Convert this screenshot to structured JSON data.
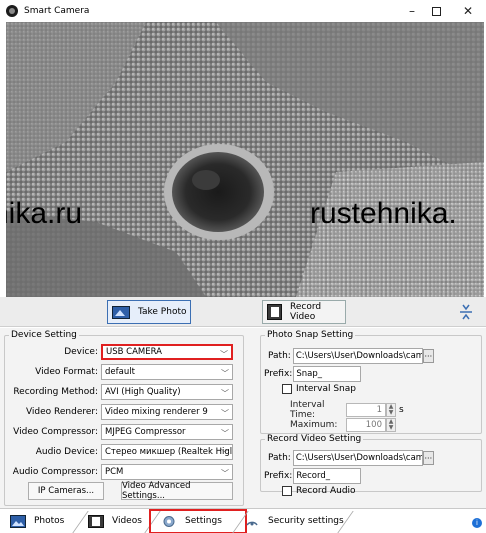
{
  "window": {
    "title": "Smart Camera",
    "controls": {
      "minimize": "–",
      "maximize": "",
      "close": "✕"
    }
  },
  "viewport": {
    "watermarks": [
      "nika.ru",
      "rustehnika."
    ]
  },
  "toolbar": {
    "take_photo": "Take Photo",
    "record_video": "Record Video"
  },
  "device_setting": {
    "legend": "Device Setting",
    "fields": [
      {
        "label": "Device:",
        "value": "USB CAMERA"
      },
      {
        "label": "Video Format:",
        "value": "default"
      },
      {
        "label": "Recording Method:",
        "value": "AVI (High Quality)"
      },
      {
        "label": "Video Renderer:",
        "value": "Video mixing renderer 9"
      },
      {
        "label": "Video Compressor:",
        "value": "MJPEG Compressor"
      },
      {
        "label": "Audio Device:",
        "value": "Стерео микшер (Realtek Higl"
      },
      {
        "label": "Audio Compressor:",
        "value": "PCM"
      }
    ],
    "ip_cameras_button": "IP Cameras...",
    "advanced_button": "Video Advanced Settings..."
  },
  "photo_snap": {
    "legend": "Photo Snap Setting",
    "path_label": "Path:",
    "path_value": "C:\\Users\\User\\Downloads\\camera",
    "browse": "···",
    "prefix_label": "Prefix:",
    "prefix_value": "Snap_",
    "interval_snap_label": "Interval Snap",
    "interval_snap_checked": false,
    "interval_time_label": "Interval Time:",
    "interval_time_value": "1",
    "interval_time_unit": "s",
    "maximum_label": "Maximum:",
    "maximum_value": "100"
  },
  "record_video_setting": {
    "legend": "Record Video Setting",
    "path_label": "Path:",
    "path_value": "C:\\Users\\User\\Downloads\\camera",
    "browse": "···",
    "prefix_label": "Prefix:",
    "prefix_value": "Record_",
    "record_audio_label": "Record Audio",
    "record_audio_checked": false
  },
  "tabs": {
    "photos": "Photos",
    "videos": "Videos",
    "settings": "Settings",
    "security": "Security settings",
    "active": "Settings",
    "info": "i"
  },
  "colors": {
    "highlight": "#e02020",
    "accent": "#3c6fb3",
    "panel_bg": "#f3f3f3"
  }
}
